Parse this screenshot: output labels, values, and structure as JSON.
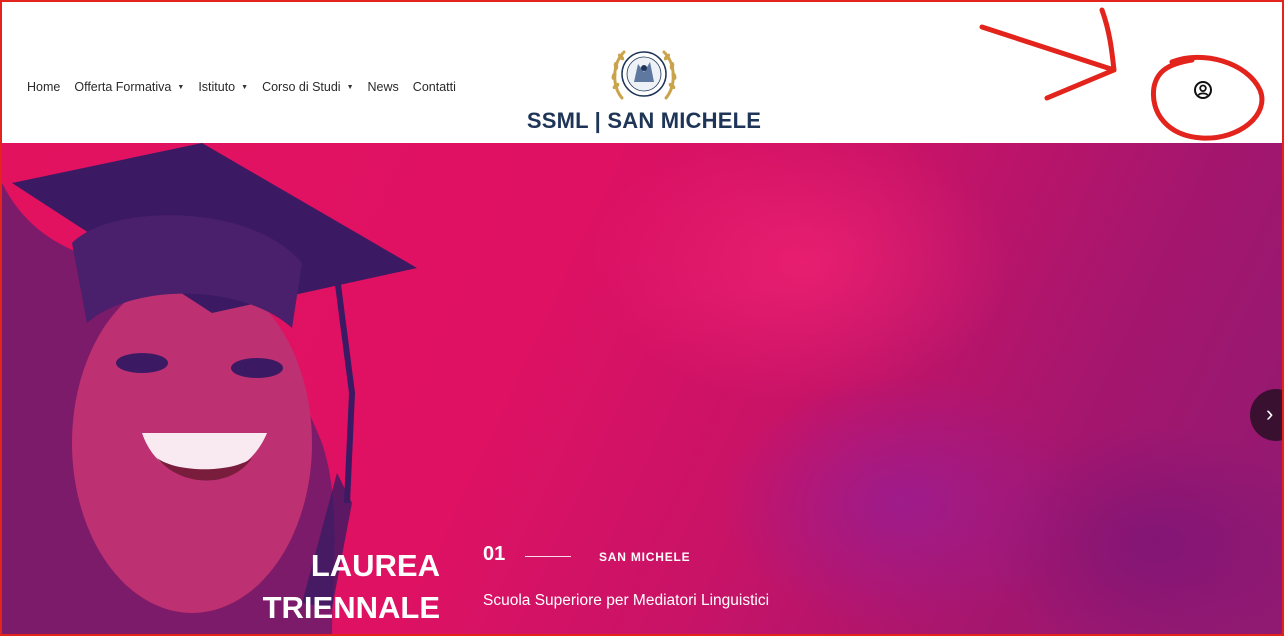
{
  "nav": {
    "items": [
      {
        "label": "Home",
        "dropdown": false
      },
      {
        "label": "Offerta Formativa",
        "dropdown": true
      },
      {
        "label": "Istituto",
        "dropdown": true
      },
      {
        "label": "Corso di Studi",
        "dropdown": true
      },
      {
        "label": "News",
        "dropdown": false
      },
      {
        "label": "Contatti",
        "dropdown": false
      }
    ],
    "caret": "▼"
  },
  "logo": {
    "brand": "SSML | SAN MICHELE",
    "brand_color": "#1e3557",
    "emblem_color": "#c9a44b"
  },
  "user_button": {
    "icon": "user-circle-icon"
  },
  "hero": {
    "title_line1": "LAUREA",
    "title_line2": "TRIENNALE",
    "slide_number": "01",
    "kicker": "SAN MICHELE",
    "subtitle": "Scuola Superiore per Mediatori Linguistici",
    "next_icon": "›",
    "bg_color": "#e2125f",
    "tint_color": "#8f1a72"
  },
  "annotation": {
    "color": "#e3241c"
  }
}
